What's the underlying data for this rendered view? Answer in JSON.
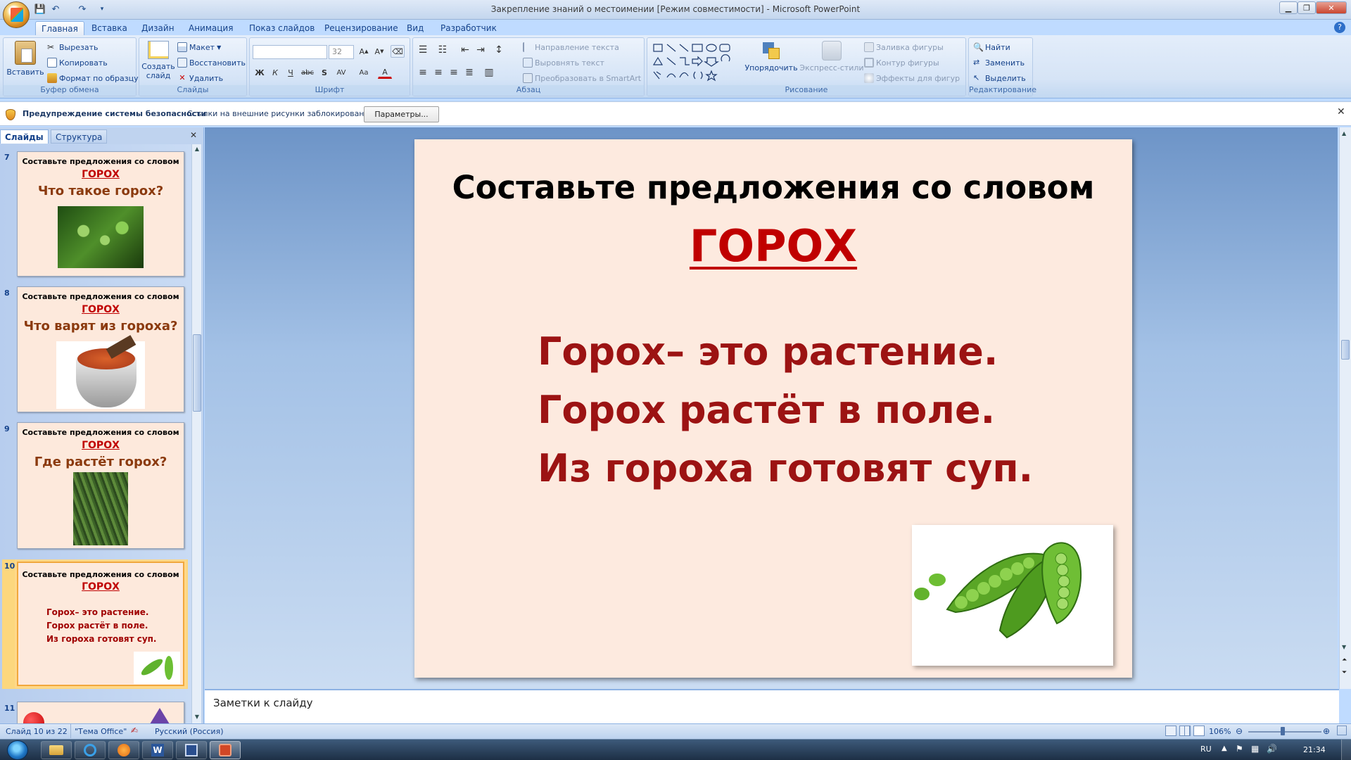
{
  "window": {
    "title": "Закрепление знаний о местоимении [Режим совместимости] - Microsoft PowerPoint"
  },
  "tabs": [
    "Главная",
    "Вставка",
    "Дизайн",
    "Анимация",
    "Показ слайдов",
    "Рецензирование",
    "Вид",
    "Разработчик"
  ],
  "ribbon": {
    "clipboard": {
      "title": "Буфер обмена",
      "paste": "Вставить",
      "cut": "Вырезать",
      "copy": "Копировать",
      "format": "Формат по образцу"
    },
    "slides": {
      "title": "Слайды",
      "new_slide_1": "Создать",
      "new_slide_2": "слайд",
      "layout": "Макет",
      "reset": "Восстановить",
      "delete": "Удалить"
    },
    "font": {
      "title": "Шрифт",
      "font_name": "",
      "font_size": "32"
    },
    "paragraph": {
      "title": "Абзац",
      "text_direction": "Направление текста",
      "align_text": "Выровнять текст",
      "smartart": "Преобразовать в SmartArt"
    },
    "drawing": {
      "title": "Рисование",
      "arrange": "Упорядочить",
      "quick_styles": "Экспресс-стили",
      "shape_fill": "Заливка фигуры",
      "shape_outline": "Контур фигуры",
      "shape_effects": "Эффекты для фигур"
    },
    "editing": {
      "title": "Редактирование",
      "find": "Найти",
      "replace": "Заменить",
      "select": "Выделить"
    }
  },
  "security": {
    "title": "Предупреждение системы безопасности",
    "message": "Ссылки на внешние рисунки заблокированы",
    "button": "Параметры..."
  },
  "panel_tabs": {
    "slides": "Слайды",
    "outline": "Структура"
  },
  "thumbnails": [
    {
      "num": "7",
      "heading": "Составьте предложения со словом",
      "word": "ГОРОХ",
      "question": "Что такое горох?"
    },
    {
      "num": "8",
      "heading": "Составьте предложения со словом",
      "word": "ГОРОХ",
      "question": "Что варят из гороха?"
    },
    {
      "num": "9",
      "heading": "Составьте предложения со словом",
      "word": "ГОРОХ",
      "question": "Где растёт горох?"
    },
    {
      "num": "10",
      "heading": "Составьте предложения со словом",
      "word": "ГОРОХ",
      "lines": [
        "Горох– это растение.",
        "Горох растёт в поле.",
        "Из гороха готовят  суп."
      ]
    },
    {
      "num": "11"
    }
  ],
  "slide": {
    "heading": "Составьте предложения со словом",
    "word": "ГОРОХ",
    "lines": [
      "Горох– это растение.",
      "Горох растёт в поле.",
      "Из гороха готовят  суп."
    ]
  },
  "notes": {
    "placeholder": "Заметки к слайду"
  },
  "status": {
    "slide_counter": "Слайд 10 из 22",
    "theme": "\"Тема Office\"",
    "language": "Русский (Россия)",
    "zoom": "106%"
  },
  "taskbar": {
    "lang": "RU",
    "time": "21:34"
  },
  "colors": {
    "accent_red": "#c00000",
    "text_dark_red": "#9c1313",
    "slide_bg": "#fdeadf"
  }
}
